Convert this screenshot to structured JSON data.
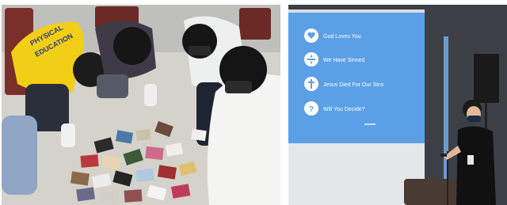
{
  "left_photo": {
    "shirt_text": [
      "PHYSICAL",
      "EDUCATION"
    ]
  },
  "right_photo": {
    "slide_items": [
      {
        "icon": "heart-icon",
        "text": "God Loves You"
      },
      {
        "icon": "divide-icon",
        "text": "We Have Sinned"
      },
      {
        "icon": "cross-icon",
        "text": "Jesus Died For Our Sins"
      },
      {
        "icon": "question-icon",
        "text": "Will You Decide?"
      }
    ],
    "colors": {
      "slide_bg": "#5ba0e6",
      "slide_item_circle": "#ffffff",
      "shirt_yellow": "#f2cf17",
      "speaker_shirt": "#111111"
    }
  }
}
